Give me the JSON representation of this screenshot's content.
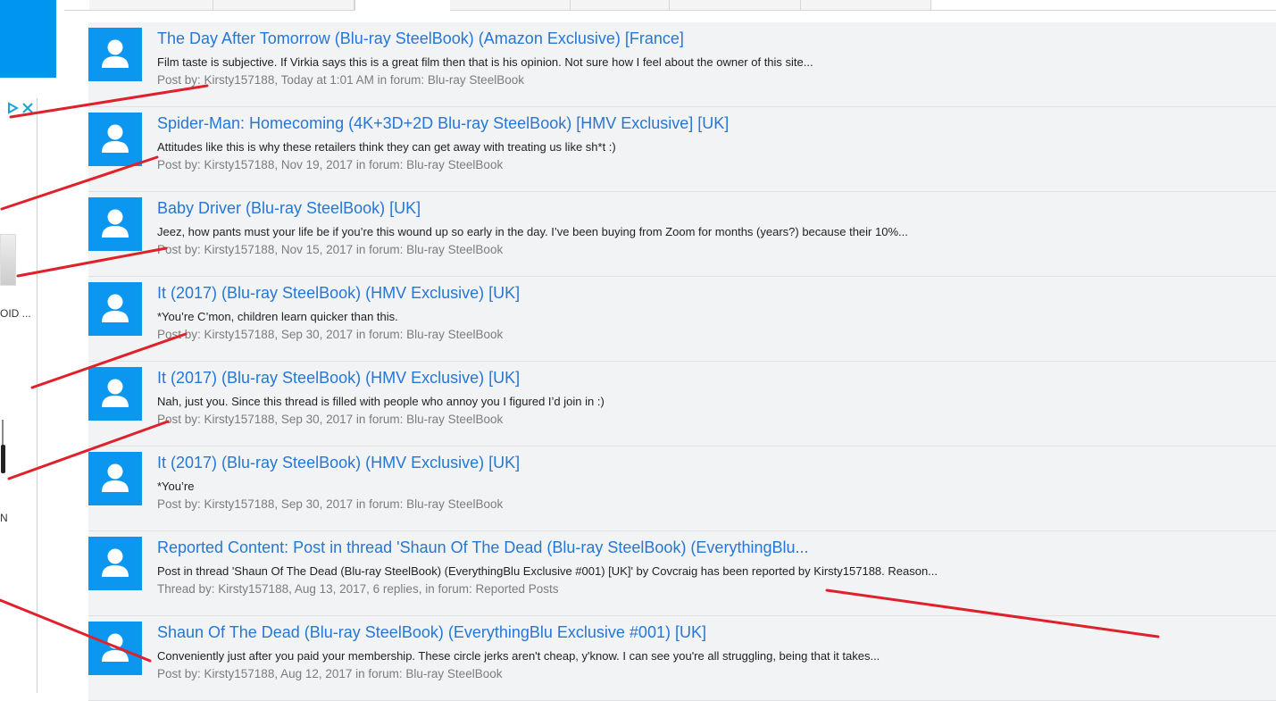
{
  "sidebar_ad": {
    "caption_1": "OID ...",
    "caption_2": "N"
  },
  "results": [
    {
      "title": "The Day After Tomorrow (Blu-ray SteelBook) (Amazon Exclusive) [France]",
      "snippet": "Film taste is subjective. If Virkia says this is a great film then that is his opinion. Not sure how I feel about the owner of this site...",
      "meta": "Post by: Kirsty157188, Today at 1:01 AM in forum: Blu-ray SteelBook"
    },
    {
      "title": "Spider-Man: Homecoming (4K+3D+2D Blu-ray SteelBook) [HMV Exclusive] [UK]",
      "snippet": "Attitudes like this is why these retailers think they can get away with treating us like sh*t :)",
      "meta": "Post by: Kirsty157188, Nov 19, 2017 in forum: Blu-ray SteelBook"
    },
    {
      "title": "Baby Driver (Blu-ray SteelBook) [UK]",
      "snippet": "Jeez, how pants must your life be if you’re this wound up so early in the day. I’ve been buying from Zoom for months (years?) because their 10%...",
      "meta": "Post by: Kirsty157188, Nov 15, 2017 in forum: Blu-ray SteelBook"
    },
    {
      "title": "It (2017) (Blu-ray SteelBook) (HMV Exclusive) [UK]",
      "snippet": "*You’re C’mon, children learn quicker than this.",
      "meta": "Post by: Kirsty157188, Sep 30, 2017 in forum: Blu-ray SteelBook"
    },
    {
      "title": "It (2017) (Blu-ray SteelBook) (HMV Exclusive) [UK]",
      "snippet": "Nah, just you. Since this thread is filled with people who annoy you I figured I’d join in :)",
      "meta": "Post by: Kirsty157188, Sep 30, 2017 in forum: Blu-ray SteelBook"
    },
    {
      "title": "It (2017) (Blu-ray SteelBook) (HMV Exclusive) [UK]",
      "snippet": "*You’re",
      "meta": "Post by: Kirsty157188, Sep 30, 2017 in forum: Blu-ray SteelBook"
    },
    {
      "title": "Reported Content: Post in thread 'Shaun Of The Dead (Blu-ray SteelBook) (EverythingBlu...",
      "snippet": "Post in thread 'Shaun Of The Dead (Blu-ray SteelBook) (EverythingBlu Exclusive #001) [UK]' by Covcraig has been reported by Kirsty157188. Reason...",
      "meta": "Thread by: Kirsty157188, Aug 13, 2017, 6 replies, in forum: Reported Posts"
    },
    {
      "title": "Shaun Of The Dead (Blu-ray SteelBook) (EverythingBlu Exclusive #001) [UK]",
      "snippet": "Conveniently just after you paid your membership. These circle jerks aren't cheap, y'know. I can see you're all struggling, being that it takes...",
      "meta": "Post by: Kirsty157188, Aug 12, 2017 in forum: Blu-ray SteelBook"
    }
  ],
  "colors": {
    "link": "#2577d6",
    "avatar": "#0b97f0",
    "annotation": "#e0202a"
  },
  "icons": {
    "avatar": "default-user-avatar-icon",
    "ad_choices": "ad-choices-icon",
    "ad_close": "close-icon"
  }
}
